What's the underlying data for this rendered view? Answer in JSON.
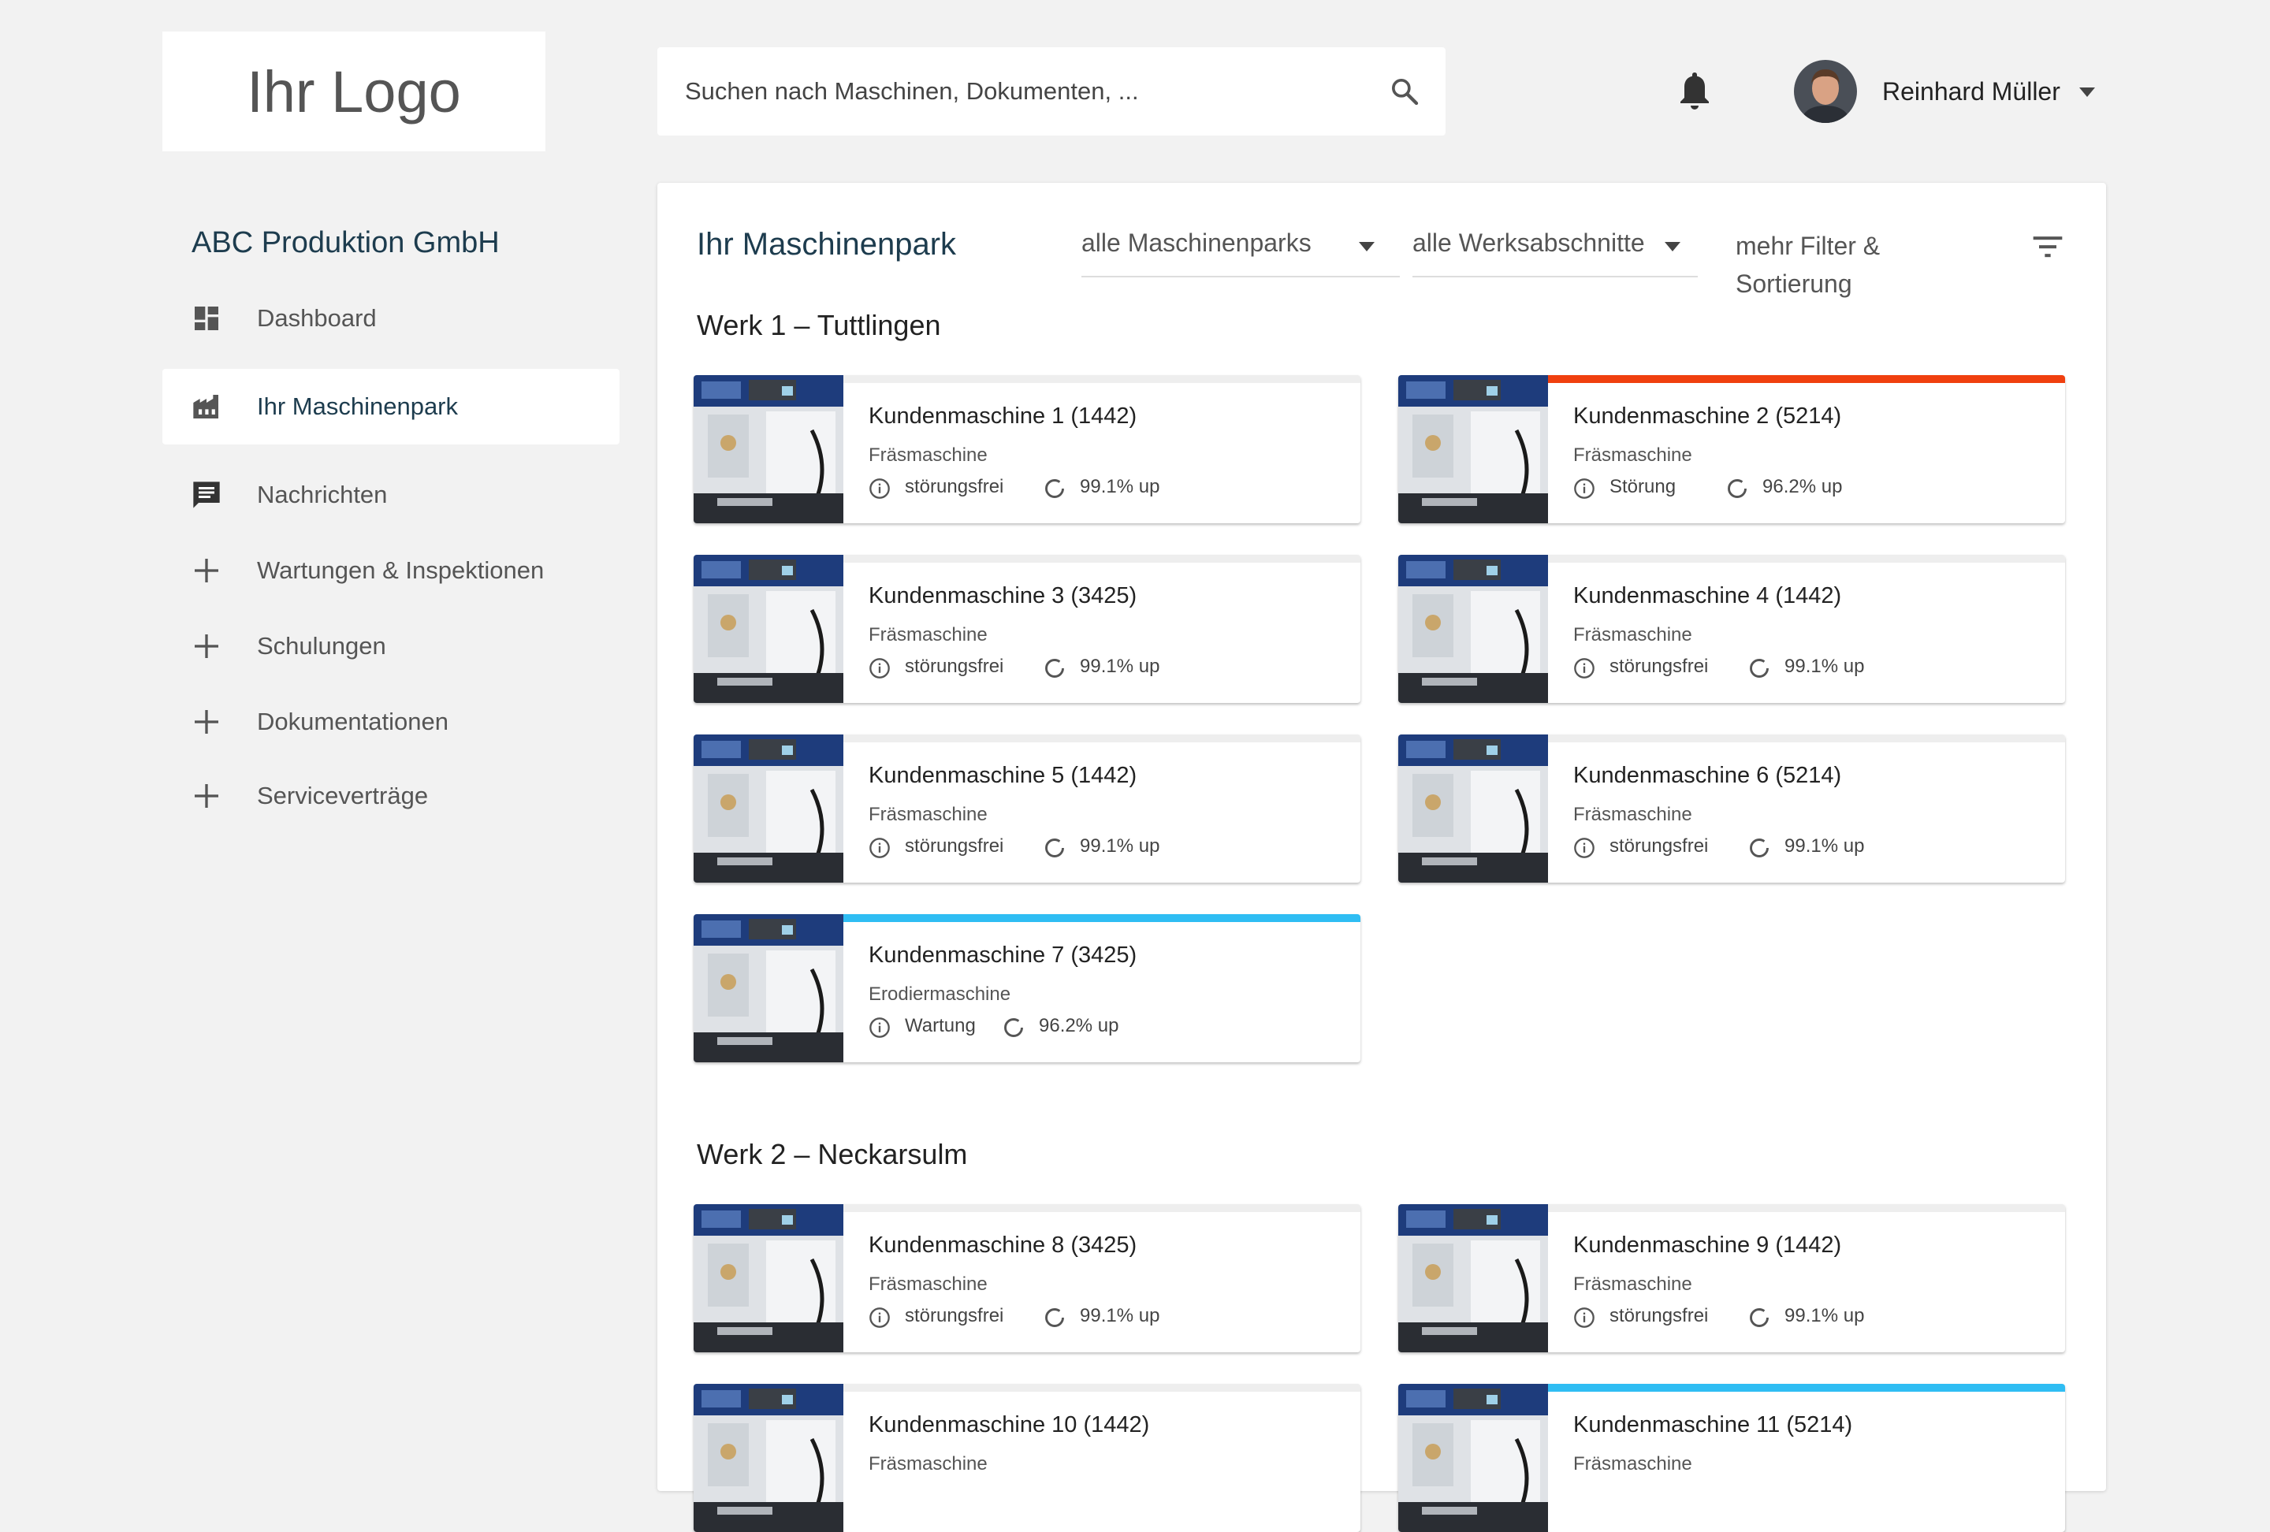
{
  "logo": {
    "text": "Ihr Logo"
  },
  "search": {
    "placeholder": "Suchen nach Maschinen, Dokumenten, ..."
  },
  "user": {
    "name": "Reinhard Müller"
  },
  "sidebar": {
    "company": "ABC Produktion GmbH",
    "items": [
      {
        "label": "Dashboard",
        "icon": "dashboard-icon"
      },
      {
        "label": "Ihr Maschinenpark",
        "icon": "factory-icon",
        "active": true
      },
      {
        "label": "Nachrichten",
        "icon": "message-icon"
      },
      {
        "label": "Wartungen & Inspektionen",
        "icon": "plus-icon"
      },
      {
        "label": "Schulungen",
        "icon": "plus-icon"
      },
      {
        "label": "Dokumentationen",
        "icon": "plus-icon"
      },
      {
        "label": "Serviceverträge",
        "icon": "plus-icon"
      }
    ]
  },
  "main": {
    "title": "Ihr Maschinenpark",
    "filters": {
      "parks": "alle Maschinenparks",
      "sections": "alle Werksabschnitte",
      "more_line1": "mehr Filter &",
      "more_line2": "Sortierung"
    },
    "sections": [
      {
        "title": "Werk 1 – Tuttlingen"
      },
      {
        "title": "Werk 2 – Neckarsulm"
      }
    ],
    "cards": [
      {
        "title": "Kundenmaschine 1 (1442)",
        "type": "Fräsmaschine",
        "status": "störungsfrei",
        "uptime": "99.1% up"
      },
      {
        "title": "Kundenmaschine 2 (5214)",
        "type": "Fräsmaschine",
        "status": "Störung",
        "uptime": "96.2% up"
      },
      {
        "title": "Kundenmaschine 3 (3425)",
        "type": "Fräsmaschine",
        "status": "störungsfrei",
        "uptime": "99.1% up"
      },
      {
        "title": "Kundenmaschine 4 (1442)",
        "type": "Fräsmaschine",
        "status": "störungsfrei",
        "uptime": "99.1% up"
      },
      {
        "title": "Kundenmaschine 5 (1442)",
        "type": "Fräsmaschine",
        "status": "störungsfrei",
        "uptime": "99.1% up"
      },
      {
        "title": "Kundenmaschine 6 (5214)",
        "type": "Fräsmaschine",
        "status": "störungsfrei",
        "uptime": "99.1% up"
      },
      {
        "title": "Kundenmaschine 7 (3425)",
        "type": "Erodiermaschine",
        "status": "Wartung",
        "uptime": "96.2% up"
      },
      {
        "title": "Kundenmaschine 8 (3425)",
        "type": "Fräsmaschine",
        "status": "störungsfrei",
        "uptime": "99.1% up"
      },
      {
        "title": "Kundenmaschine 9 (1442)",
        "type": "Fräsmaschine",
        "status": "störungsfrei",
        "uptime": "99.1% up"
      },
      {
        "title": "Kundenmaschine 10 (1442)",
        "type": "Fräsmaschine",
        "status": "",
        "uptime": ""
      },
      {
        "title": "Kundenmaschine 11 (5214)",
        "type": "Fräsmaschine",
        "status": "",
        "uptime": ""
      }
    ]
  },
  "colors": {
    "brand": "#1d3c4e",
    "status_error": "#f0400f",
    "status_maintenance": "#2fbdf3",
    "card_bar_default": "#eeeeee"
  }
}
